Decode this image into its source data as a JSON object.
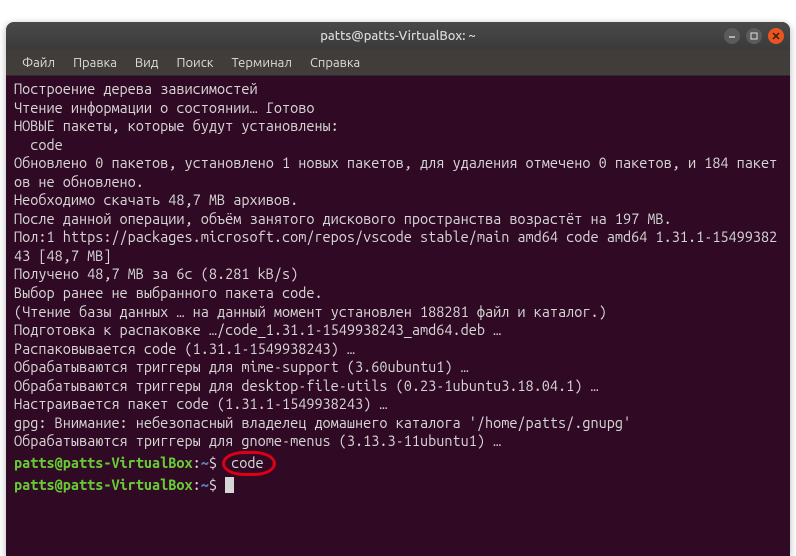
{
  "window": {
    "title": "patts@patts-VirtualBox: ~"
  },
  "menu": {
    "file": "Файл",
    "edit": "Правка",
    "view": "Вид",
    "search": "Поиск",
    "terminal": "Терминал",
    "help": "Справка"
  },
  "out": {
    "l0": "Построение дерева зависимостей",
    "l1": "Чтение информации о состоянии… Готово",
    "l2": "НОВЫЕ пакеты, которые будут установлены:",
    "l3": "  code",
    "l4": "Обновлено 0 пакетов, установлено 1 новых пакетов, для удаления отмечено 0 пакетов, и 184 пакетов не обновлено.",
    "l5": "Необходимо скачать 48,7 MB архивов.",
    "l6": "После данной операции, объём занятого дискового пространства возрастёт на 197 MB.",
    "l7": "Пол:1 https://packages.microsoft.com/repos/vscode stable/main amd64 code amd64 1.31.1-1549938243 [48,7 MB]",
    "l8": "Получено 48,7 MB за 6с (8.281 kB/s)",
    "l9": "Выбор ранее не выбранного пакета code.",
    "l10": "(Чтение базы данных … на данный момент установлен 188281 файл и каталог.)",
    "l11": "Подготовка к распаковке …/code_1.31.1-1549938243_amd64.deb …",
    "l12": "Распаковывается code (1.31.1-1549938243) …",
    "l13": "Обрабатываются триггеры для mime-support (3.60ubuntu1) …",
    "l14": "Обрабатываются триггеры для desktop-file-utils (0.23-1ubuntu3.18.04.1) …",
    "l15": "Настраивается пакет code (1.31.1-1549938243) …",
    "l16": "gpg: Внимание: небезопасный владелец домашнего каталога '/home/patts/.gnupg'",
    "l17": "Обрабатываются триггеры для gnome-menus (3.13.3-11ubuntu1) …"
  },
  "prompt": {
    "userhost": "patts@patts-VirtualBox",
    "sep": ":",
    "path": "~",
    "dollar": "$",
    "cmd1": "code"
  }
}
